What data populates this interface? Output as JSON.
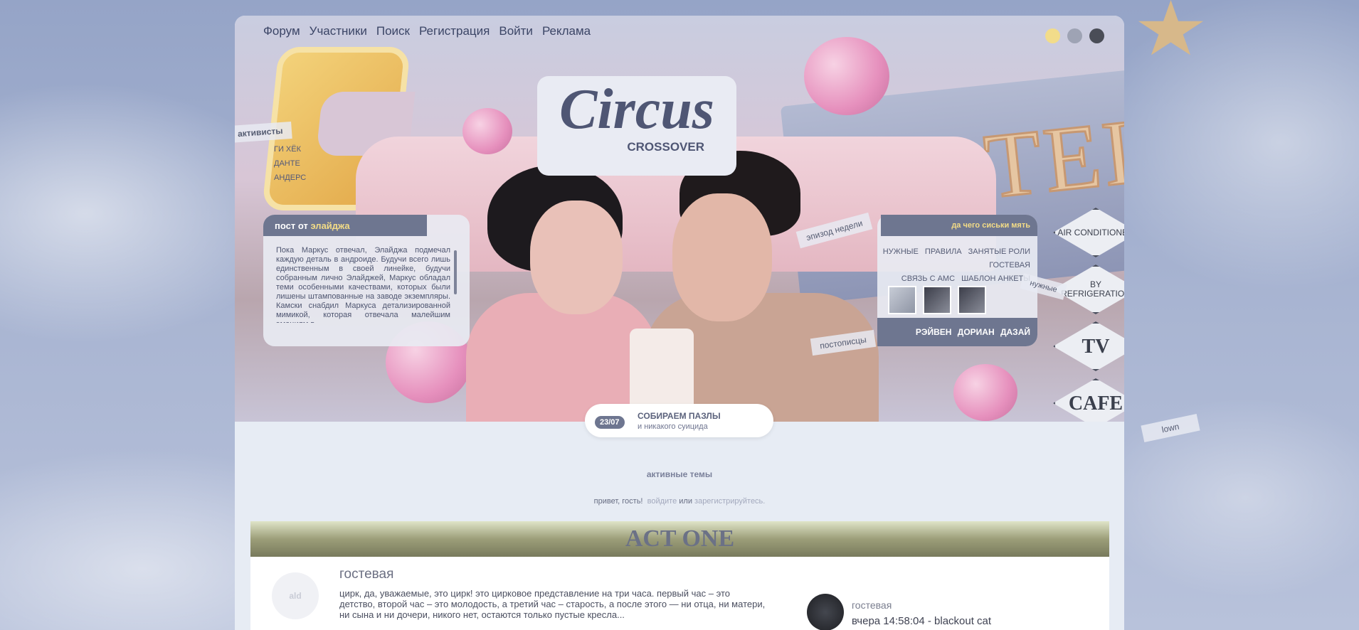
{
  "nav": [
    "Форум",
    "Участники",
    "Поиск",
    "Регистрация",
    "Войти",
    "Реклама"
  ],
  "theme_dots": [
    "#f2dc8a",
    "#9ea3b4",
    "#4a4d57"
  ],
  "logo": {
    "title": "Circus",
    "sub": "CROSSOVER"
  },
  "activists": {
    "label": "активисты",
    "names": [
      "ГИ ХЁК",
      "ДАНТЕ",
      "АНДЕРС"
    ]
  },
  "post": {
    "prefix": "пост от",
    "name": "элайджа",
    "text": "Пока Маркус отвечал, Элайджа подмечал каждую деталь в андроиде. Будучи всего лишь единственным в своей линейке, будучи собранным лично Элайджей, Маркус обладал теми особенными качествами, которых были лишены штампованные на заводе экземпляры. Камски снабдил Маркуса детализированной мимикой, которая отвечала малейшим эмоциям в"
  },
  "episode_tape": "эпизод недели",
  "right": {
    "head": "да чего сиськи мять",
    "links_row1": [
      "НУЖНЫЕ",
      "ПРАВИЛА",
      "ЗАНЯТЫЕ РОЛИ",
      "ГОСТЕВАЯ"
    ],
    "links_row2": [
      "СВЯЗЬ С АМС",
      "ШАБЛОН АНКЕТЫ"
    ],
    "posters_label": "постописцы",
    "posters": [
      "РЭЙВЕН",
      "ДОРИАН",
      "ДАЗАЙ"
    ]
  },
  "tape_needed": "нужные",
  "tape_lown": "lown",
  "signs": [
    "AIR CONDITIONED",
    "BY REFRIGERATION",
    "TV",
    "CAFE"
  ],
  "motel": "MOTEL",
  "announce": {
    "date": "23/07",
    "title": "СОБИРАЕМ ПАЗЛЫ",
    "sub": "и никакого суицида"
  },
  "active_topics": "активные темы",
  "greeting": {
    "hello": "привет, гость!",
    "login": "войдите",
    "or": "или",
    "register": "зарегистрируйтесь."
  },
  "category": "ACT ONE",
  "forum": {
    "icon": "ald",
    "title": "гостевая",
    "desc": "цирк, да, уважаемые, это цирк! это цирковое представление на три часа. первый час – это детство, второй час – это молодость, а третий час – старость, а после этого — ни отца, ни матери, ни сына и ни дочери, никого нет, остаются только пустые кресла...",
    "last_forum": "гостевая",
    "last_post": "вчера 14:58:04 - blackout cat"
  }
}
